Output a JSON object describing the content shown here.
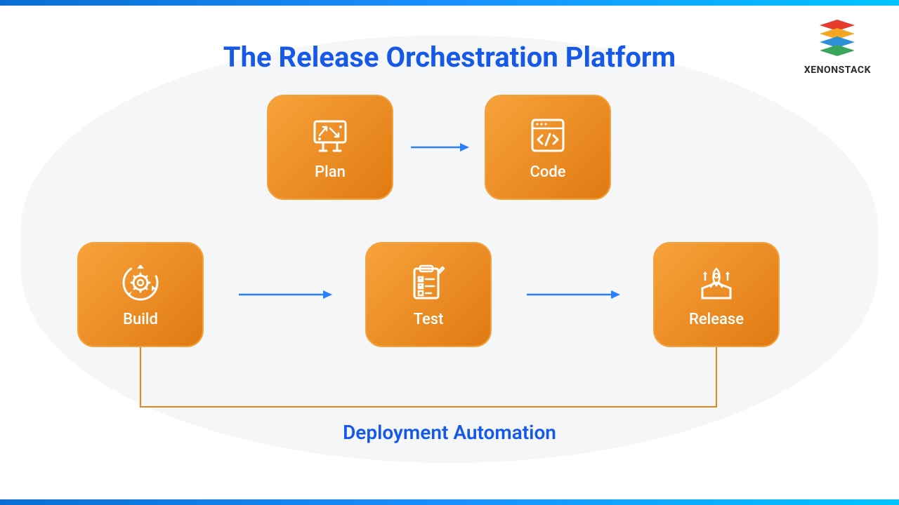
{
  "title": "The Release Orchestration Platform",
  "subtitle": "Deployment Automation",
  "brand": {
    "name": "XENONSTACK"
  },
  "stages": {
    "row1": [
      {
        "label": "Plan",
        "icon": "plan-board-icon"
      },
      {
        "label": "Code",
        "icon": "code-window-icon"
      }
    ],
    "row2": [
      {
        "label": "Build",
        "icon": "gear-cycle-icon"
      },
      {
        "label": "Test",
        "icon": "test-checklist-icon"
      },
      {
        "label": "Release",
        "icon": "release-rocket-icon"
      }
    ]
  },
  "colors": {
    "title": "#1659e8",
    "stage_bg_start": "#f7a23b",
    "stage_bg_end": "#e17a12",
    "arrow": "#2a7fff",
    "bracket": "#e28a1e"
  }
}
